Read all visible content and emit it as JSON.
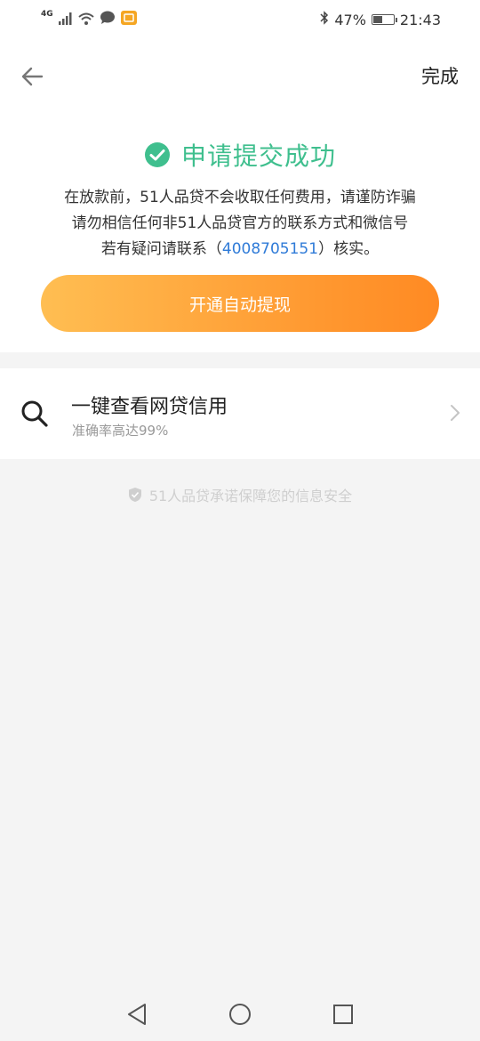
{
  "status_bar": {
    "network": "4G",
    "battery": "47%",
    "battery_level": 0.47,
    "time": "21:43",
    "icons": [
      "signal-icon",
      "wifi-icon",
      "chat-icon",
      "app-notification-icon",
      "bluetooth-icon",
      "battery-icon"
    ]
  },
  "nav": {
    "back_icon": "back-arrow-icon",
    "done_label": "完成"
  },
  "success": {
    "icon": "check-circle-icon",
    "title": "申请提交成功",
    "color": "#3fbf8e"
  },
  "notice": {
    "line1": "在放款前，51人品贷不会收取任何费用，请谨防诈骗",
    "line2": "请勿相信任何非51人品贷官方的联系方式和微信号",
    "line3_prefix": "若有疑问请联系（",
    "phone": "4008705151",
    "line3_suffix": "）核实。"
  },
  "primary_button": {
    "label": "开通自动提现",
    "gradient_start": "#ffbe52",
    "gradient_end": "#ff8a23"
  },
  "credit_check": {
    "icon": "search-icon",
    "title": "一键查看网贷信用",
    "subtitle": "准确率高达99%"
  },
  "security_note": {
    "icon": "shield-check-icon",
    "text": "51人品贷承诺保障您的信息安全"
  },
  "system_nav": [
    "back-triangle-icon",
    "home-circle-icon",
    "recents-square-icon"
  ]
}
